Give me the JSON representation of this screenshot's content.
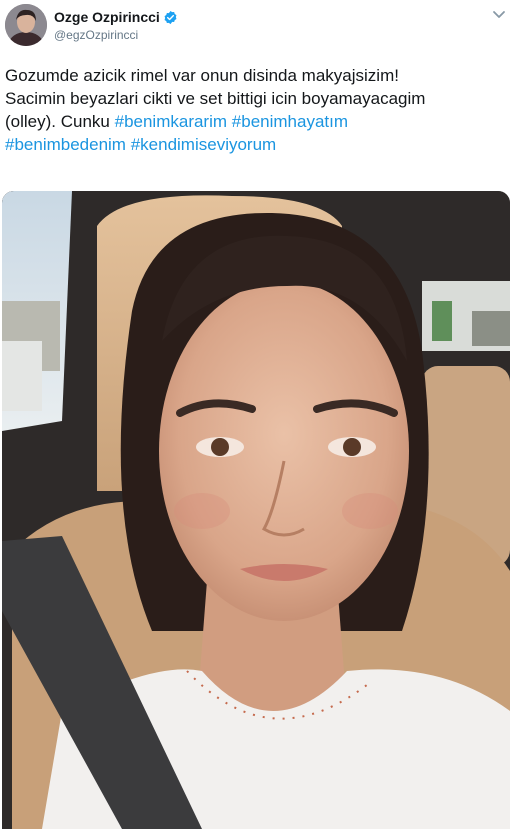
{
  "author": {
    "display_name": "Ozge Ozpirincci",
    "handle": "@egzOzpirincci",
    "verified": true,
    "avatar_icon": "profile-photo-avatar"
  },
  "menu_icon": "chevron-down-icon",
  "tweet": {
    "line1": "Gozumde azicik rimel var onun disinda makyajsizim!",
    "line2": "Sacimin beyazlari cikti ve set bittigi icin boyamayacagim",
    "line3_text": "(olley). Cunku ",
    "hashtags": [
      "#benimkararim",
      "#benimhayatım",
      "#benimbedenim",
      "#kendimiseviyorum"
    ]
  },
  "colors": {
    "text": "#14171a",
    "secondary": "#657786",
    "link": "#1b95e0",
    "verified": "#1da1f2"
  },
  "media": {
    "type": "photo",
    "subject": "selfie"
  }
}
